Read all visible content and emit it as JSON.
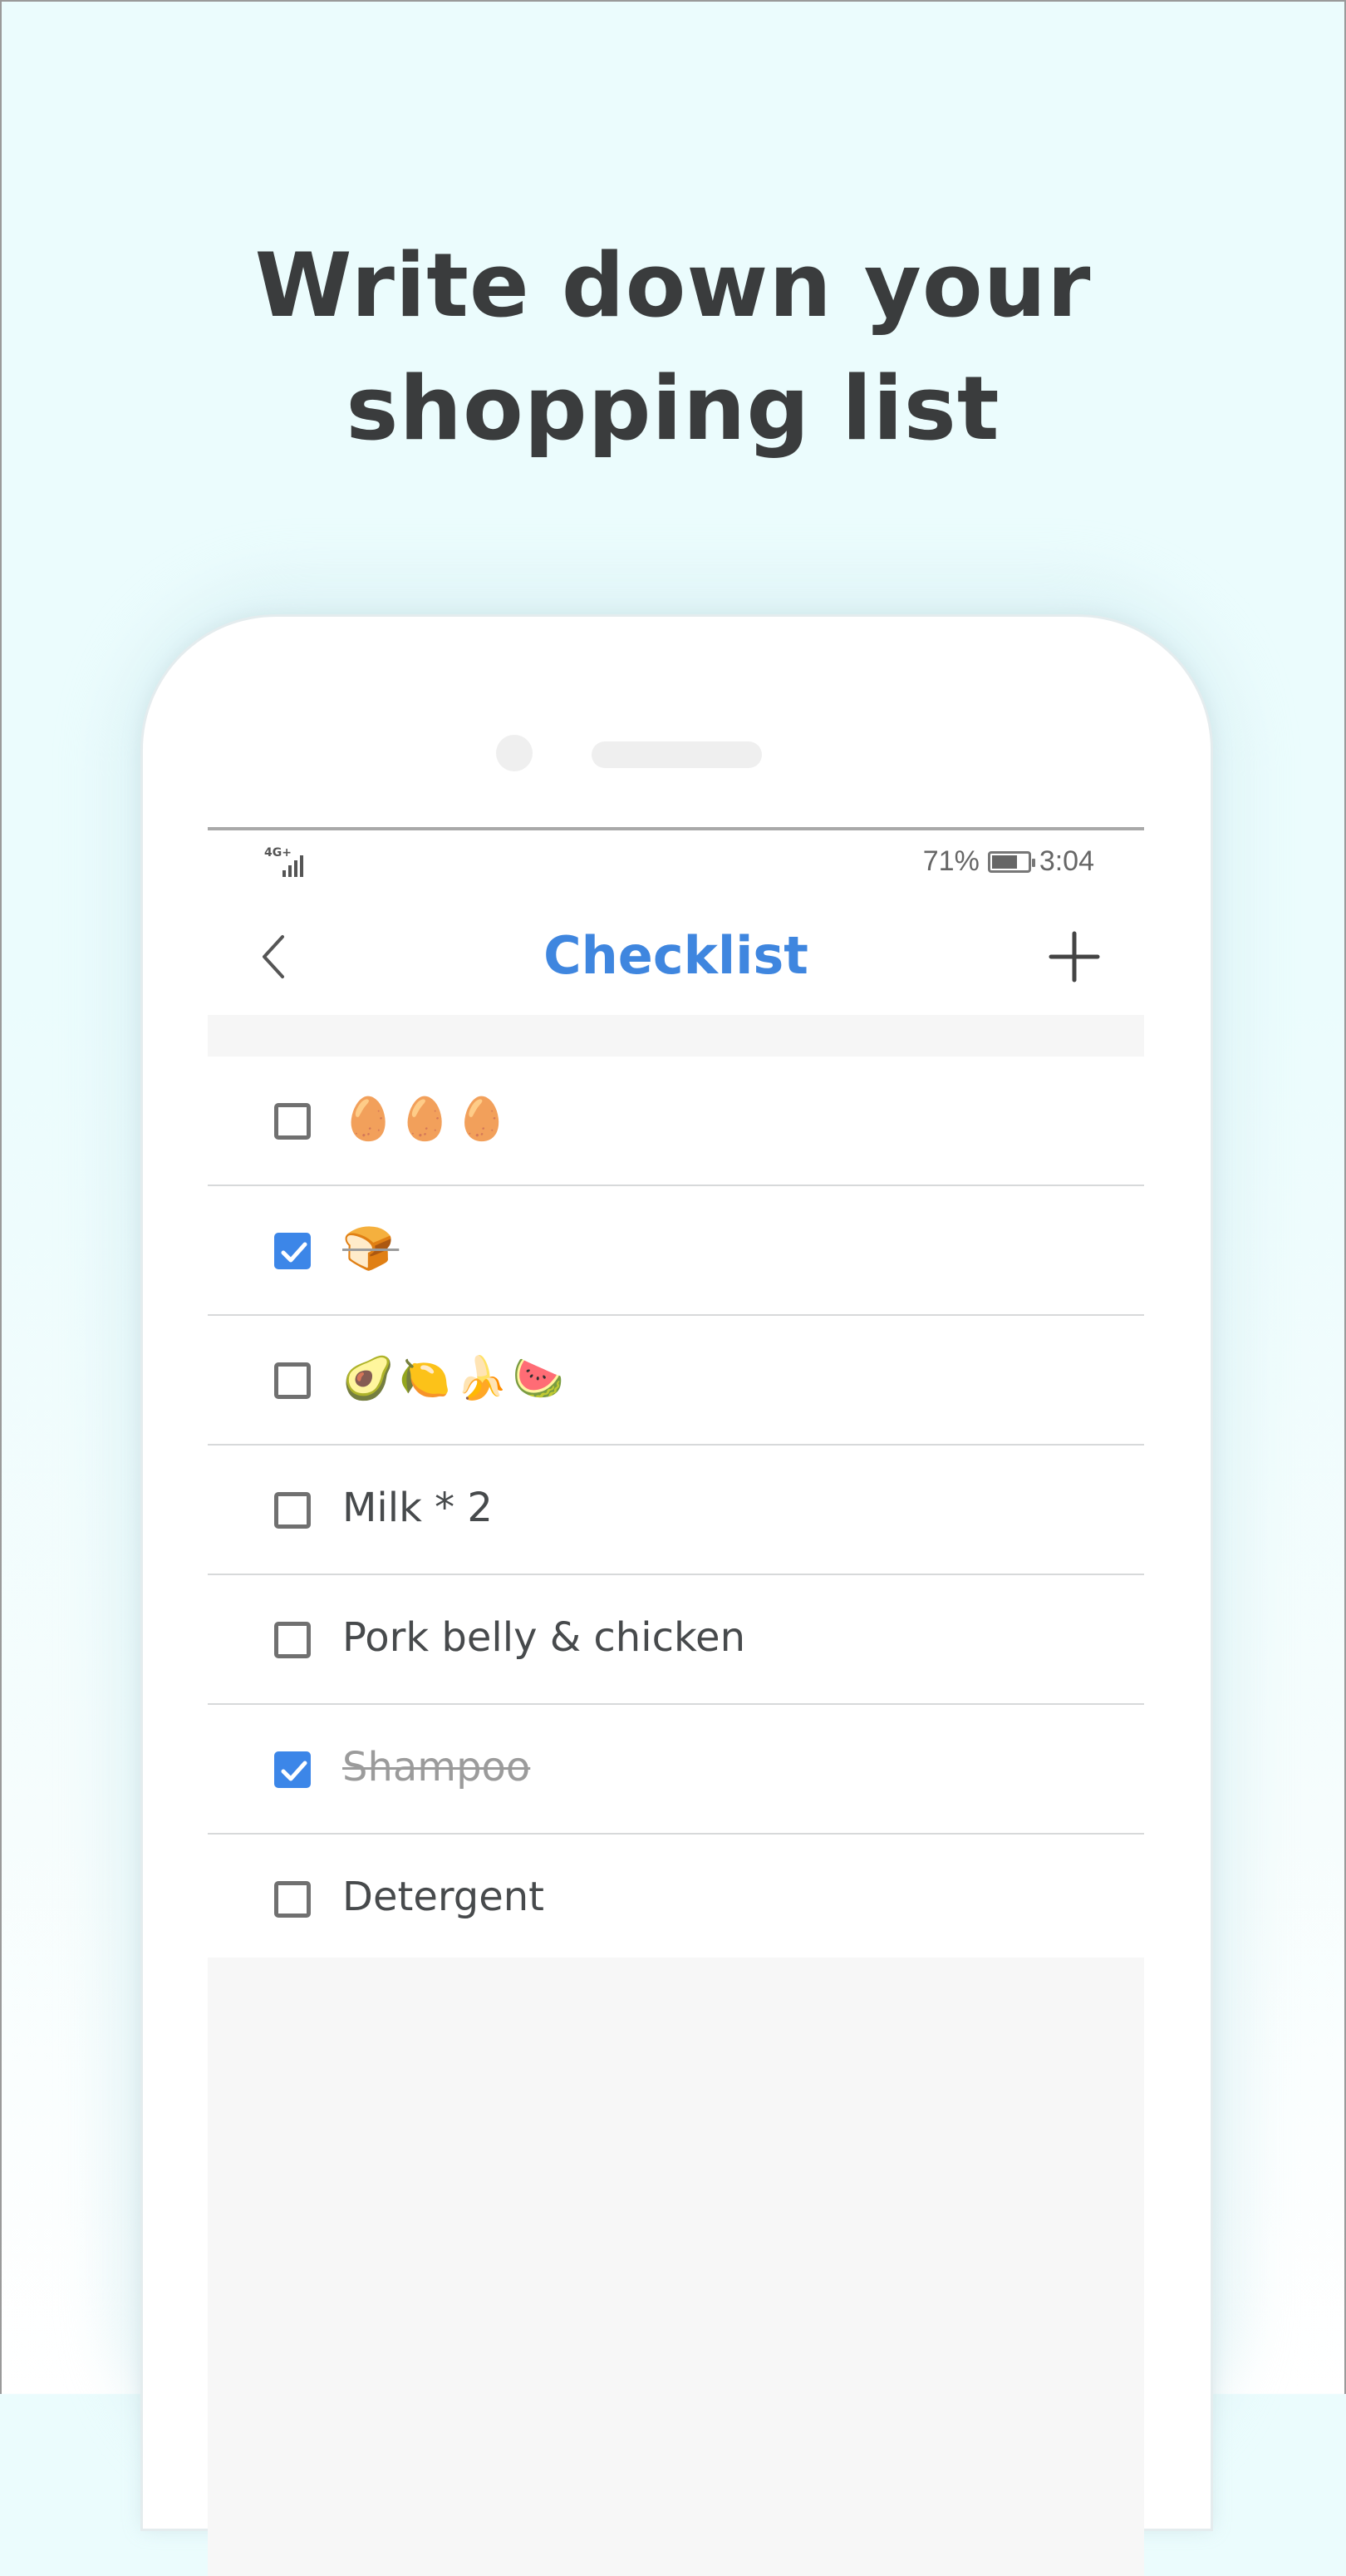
{
  "headline": {
    "line1": "Write down your",
    "line2": "shopping list"
  },
  "status_bar": {
    "network": "4G+",
    "battery_percent": "71%",
    "battery_level": 0.71,
    "time": "3:04"
  },
  "toolbar": {
    "title": "Checklist",
    "back_icon": "chevron-left-icon",
    "add_icon": "plus-icon"
  },
  "checklist": {
    "items": [
      {
        "text": "🥚🥚🥚",
        "checked": false,
        "is_emoji": true
      },
      {
        "text": "🍞",
        "checked": true,
        "is_emoji": true
      },
      {
        "text": "🥑🍋🍌🍉",
        "checked": false,
        "is_emoji": true
      },
      {
        "text": "Milk * 2",
        "checked": false,
        "is_emoji": false
      },
      {
        "text": "Pork belly & chicken",
        "checked": false,
        "is_emoji": false
      },
      {
        "text": "Shampoo",
        "checked": true,
        "is_emoji": false
      },
      {
        "text": "Detergent",
        "checked": false,
        "is_emoji": false
      }
    ]
  },
  "colors": {
    "accent": "#3f86df",
    "checkbox_checked": "#3c86e8",
    "background": "#ebfcfd",
    "headline": "#3a3c3d"
  }
}
